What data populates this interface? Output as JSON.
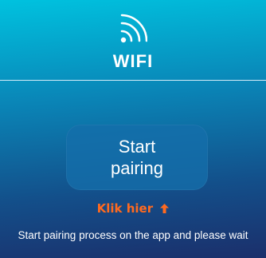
{
  "header": {
    "icon": "wifi-icon",
    "title": "WIFI"
  },
  "main": {
    "start_button_label": "Start pairing",
    "klik_label": "Klik hier",
    "klik_icon": "arrow-up-icon",
    "hint": "Start pairing process on the app and please wait"
  },
  "colors": {
    "bg_top": "#00c2df",
    "bg_bottom": "#1b2f6b",
    "button": "#146eaa",
    "accent": "#ff6a1f"
  }
}
